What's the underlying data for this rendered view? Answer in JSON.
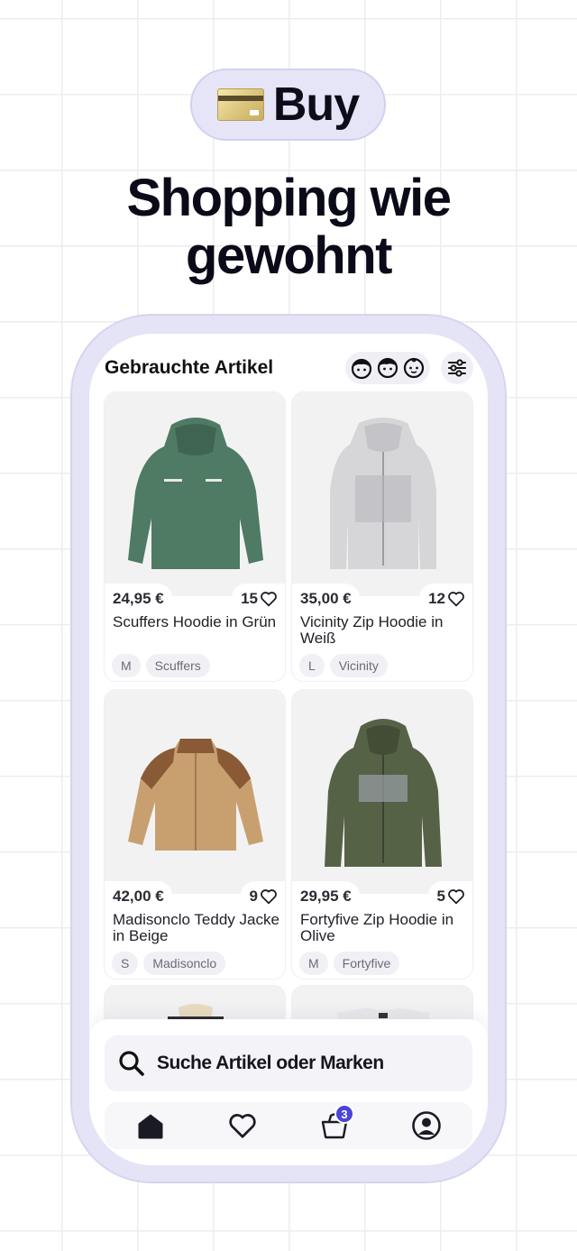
{
  "banner": {
    "label": "Buy",
    "icon": "credit-card-icon"
  },
  "headline": {
    "line1": "Shopping wie",
    "line2": "gewohnt"
  },
  "screen": {
    "title": "Gebrauchte Artikel",
    "filter_icons": [
      "girl-face-icon",
      "boy-face-icon",
      "child-face-icon",
      "filter-sliders-icon"
    ]
  },
  "products": [
    {
      "price": "24,95 €",
      "likes": "15",
      "name": "Scuffers Hoodie in Grün",
      "size": "M",
      "brand": "Scuffers",
      "color": "#4f7a63"
    },
    {
      "price": "35,00 €",
      "likes": "12",
      "name": "Vicinity Zip Hoodie in Weiß",
      "size": "L",
      "brand": "Vicinity",
      "color": "#d6d6d9"
    },
    {
      "price": "42,00 €",
      "likes": "9",
      "name": "Madisonclo Teddy Jacke in Beige",
      "size": "S",
      "brand": "Madisonclo",
      "color": "#c8a070"
    },
    {
      "price": "29,95 €",
      "likes": "5",
      "name": "Fortyfive Zip Hoodie in Olive",
      "size": "M",
      "brand": "Fortyfive",
      "color": "#566246"
    }
  ],
  "search": {
    "placeholder": "Suche Artikel oder Marken"
  },
  "nav": {
    "items": [
      "home-icon",
      "heart-icon",
      "basket-icon",
      "profile-icon"
    ],
    "cart_badge": "3"
  },
  "colors": {
    "accent": "#4a44d8",
    "phone_frame": "#e5e4f6"
  }
}
